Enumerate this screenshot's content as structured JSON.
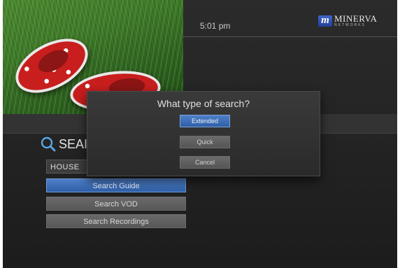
{
  "clock": {
    "time": "5:01 pm"
  },
  "brand": {
    "mark": "m",
    "name": "MINERVA",
    "sub": "NETWORKS"
  },
  "search": {
    "title": "SEAI",
    "query": "HOUSE",
    "buttons": [
      {
        "label": "Search Guide",
        "selected": true
      },
      {
        "label": "Search VOD",
        "selected": false
      },
      {
        "label": "Search Recordings",
        "selected": false
      }
    ]
  },
  "dialog": {
    "title": "What type of search?",
    "options": [
      {
        "label": "Extended",
        "selected": true
      },
      {
        "label": "Quick",
        "selected": false
      },
      {
        "label": "Cancel",
        "selected": false
      }
    ]
  },
  "colors": {
    "accent": "#2f5fa8",
    "background": "#262626",
    "button": "#5f5f5f"
  }
}
